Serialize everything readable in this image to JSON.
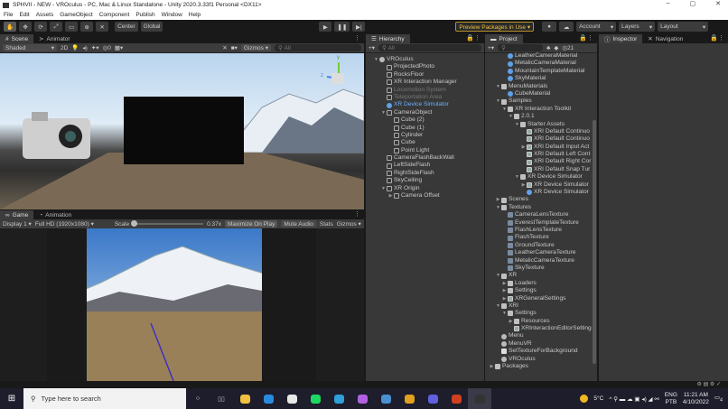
{
  "title": "SPHVII - NEW - VROculus - PC, Mac & Linux Standalone - Unity 2020.3.33f1 Personal <DX11>",
  "window_controls": [
    "–",
    "▢",
    "✕"
  ],
  "menu": [
    "File",
    "Edit",
    "Assets",
    "GameObject",
    "Component",
    "Publish",
    "Window",
    "Help"
  ],
  "toolbar": {
    "tools": [
      "✋",
      "✥",
      "⟳",
      "⤢",
      "▭",
      "⊕",
      "✕"
    ],
    "pivot": "Center",
    "space": "Global",
    "play": "▶",
    "pause": "❚❚",
    "step": "▶|",
    "preview": "Preview Packages in Use ▾",
    "account": "Account",
    "layers": "Layers",
    "layout": "Layout"
  },
  "scene": {
    "tabs": [
      "Scene",
      "Animator"
    ],
    "shading": "Shaded",
    "mode2d": "2D",
    "gizmos": "Gizmos",
    "search": "All",
    "axis_z": "z",
    "axis_y": "y"
  },
  "game": {
    "tabs": [
      "Game",
      "Animation"
    ],
    "display": "Display 1",
    "resolution": "Full HD (1920x1080)",
    "scale_label": "Scale",
    "scale_value": "0.37x",
    "scale_fraction": 0.0,
    "maximize": "Maximize On Play",
    "mute": "Mute Audio",
    "stats": "Stats",
    "gizmos": "Gizmos"
  },
  "hierarchy": {
    "tab": "Hierarchy",
    "search": "All",
    "items": [
      {
        "label": "VROculus",
        "level": 0,
        "icon": "scene",
        "arrow": "▼"
      },
      {
        "label": "ProjectedPhoto",
        "level": 1,
        "icon": "go"
      },
      {
        "label": "RocksFloor",
        "level": 1,
        "icon": "go"
      },
      {
        "label": "XR Interaction Manager",
        "level": 1,
        "icon": "go"
      },
      {
        "label": "Locomotion System",
        "level": 1,
        "icon": "go",
        "state": "dim"
      },
      {
        "label": "Teleportation Area",
        "level": 1,
        "icon": "go",
        "state": "dim"
      },
      {
        "label": "XR Device Simulator",
        "level": 1,
        "icon": "mat",
        "state": "sel"
      },
      {
        "label": "CameraObject",
        "level": 1,
        "icon": "go",
        "arrow": "▼"
      },
      {
        "label": "Cube (2)",
        "level": 2,
        "icon": "go"
      },
      {
        "label": "Cube (1)",
        "level": 2,
        "icon": "go"
      },
      {
        "label": "Cylinder",
        "level": 2,
        "icon": "go"
      },
      {
        "label": "Cube",
        "level": 2,
        "icon": "go"
      },
      {
        "label": "Point Light",
        "level": 2,
        "icon": "go"
      },
      {
        "label": "CameraFlashBackWall",
        "level": 1,
        "icon": "go"
      },
      {
        "label": "LeftSideFlash",
        "level": 1,
        "icon": "go"
      },
      {
        "label": "RightSideFlash",
        "level": 1,
        "icon": "go"
      },
      {
        "label": "SkyCeiling",
        "level": 1,
        "icon": "go"
      },
      {
        "label": "XR Origin",
        "level": 1,
        "icon": "go",
        "arrow": "▼"
      },
      {
        "label": "Camera Offset",
        "level": 2,
        "icon": "go",
        "arrow": "▶"
      }
    ]
  },
  "project": {
    "tab": "Project",
    "count": "21",
    "items": [
      {
        "label": "LeatherCameraMaterial",
        "level": 2,
        "icon": "mat"
      },
      {
        "label": "MetalicCameraMaterial",
        "level": 2,
        "icon": "mat"
      },
      {
        "label": "MountainTemplateMaterial",
        "level": 2,
        "icon": "mat"
      },
      {
        "label": "SkyMaterial",
        "level": 2,
        "icon": "mat"
      },
      {
        "label": "MenuMaterials",
        "level": 1,
        "icon": "folder",
        "arrow": "▼"
      },
      {
        "label": "CubeMaterial",
        "level": 2,
        "icon": "mat"
      },
      {
        "label": "Samples",
        "level": 1,
        "icon": "folder",
        "arrow": "▼"
      },
      {
        "label": "XR Interaction Toolkit",
        "level": 2,
        "icon": "folder",
        "arrow": "▼"
      },
      {
        "label": "2.0.1",
        "level": 3,
        "icon": "folder",
        "arrow": "▼"
      },
      {
        "label": "Starter Assets",
        "level": 4,
        "icon": "folder",
        "arrow": "▼"
      },
      {
        "label": "XRI Default Continuo",
        "level": 5,
        "icon": "asset"
      },
      {
        "label": "XRI Default Continuo",
        "level": 5,
        "icon": "asset"
      },
      {
        "label": "XRI Default Input Act",
        "level": 5,
        "icon": "asset",
        "arrow": "▶"
      },
      {
        "label": "XRI Default Left Cont",
        "level": 5,
        "icon": "asset"
      },
      {
        "label": "XRI Default Right Cor",
        "level": 5,
        "icon": "asset"
      },
      {
        "label": "XRI Default Snap Tur",
        "level": 5,
        "icon": "asset"
      },
      {
        "label": "XR Device Simulator",
        "level": 4,
        "icon": "folder",
        "arrow": "▼"
      },
      {
        "label": "XR Device Simulator",
        "level": 5,
        "icon": "asset",
        "arrow": "▶"
      },
      {
        "label": "XR Device Simulator",
        "level": 5,
        "icon": "mat"
      },
      {
        "label": "Scenes",
        "level": 1,
        "icon": "folder",
        "arrow": "▶"
      },
      {
        "label": "Textures",
        "level": 1,
        "icon": "folder",
        "arrow": "▼"
      },
      {
        "label": "CameraLensTexture",
        "level": 2,
        "icon": "tex"
      },
      {
        "label": "EverestTemplateTexture",
        "level": 2,
        "icon": "tex"
      },
      {
        "label": "FlashLensTexture",
        "level": 2,
        "icon": "tex"
      },
      {
        "label": "FlashTexture",
        "level": 2,
        "icon": "tex"
      },
      {
        "label": "GroundTexture",
        "level": 2,
        "icon": "tex"
      },
      {
        "label": "LeatherCameraTexture",
        "level": 2,
        "icon": "tex"
      },
      {
        "label": "MetalicCameraTexture",
        "level": 2,
        "icon": "tex"
      },
      {
        "label": "SkyTexture",
        "level": 2,
        "icon": "tex"
      },
      {
        "label": "XR",
        "level": 1,
        "icon": "folder",
        "arrow": "▼"
      },
      {
        "label": "Loaders",
        "level": 2,
        "icon": "folder",
        "arrow": "▶"
      },
      {
        "label": "Settings",
        "level": 2,
        "icon": "folder",
        "arrow": "▶"
      },
      {
        "label": "XRGeneralSettings",
        "level": 2,
        "icon": "asset",
        "arrow": "▶"
      },
      {
        "label": "XRI",
        "level": 1,
        "icon": "folder",
        "arrow": "▼"
      },
      {
        "label": "Settings",
        "level": 2,
        "icon": "folder",
        "arrow": "▼"
      },
      {
        "label": "Resources",
        "level": 3,
        "icon": "folder",
        "arrow": "▶"
      },
      {
        "label": "XRInteractionEditorSetting",
        "level": 3,
        "icon": "asset"
      },
      {
        "label": "Menu",
        "level": 1,
        "icon": "scene"
      },
      {
        "label": "MenuVR",
        "level": 1,
        "icon": "scene"
      },
      {
        "label": "SetTextureForBackground",
        "level": 1,
        "icon": "script"
      },
      {
        "label": "VROculus",
        "level": 1,
        "icon": "scene"
      },
      {
        "label": "Packages",
        "level": 0,
        "icon": "folder",
        "arrow": "▶"
      }
    ]
  },
  "inspector": {
    "tabs": [
      "Inspector",
      "Navigation"
    ]
  },
  "taskbar": {
    "search_placeholder": "Type here to search",
    "weather": "5°C",
    "lang1": "ENG",
    "lang2": "PTB",
    "time": "11:21 AM",
    "date": "4/10/2022",
    "notifications": "4",
    "apps": [
      {
        "name": "file-explorer",
        "color": "#f0c040"
      },
      {
        "name": "mail",
        "color": "#2a8ae0"
      },
      {
        "name": "store",
        "color": "#e8e8e8"
      },
      {
        "name": "spotify",
        "color": "#1ed760"
      },
      {
        "name": "edge",
        "color": "#2fa0d8"
      },
      {
        "name": "app",
        "color": "#b060e0"
      },
      {
        "name": "steam",
        "color": "#4a90d0"
      },
      {
        "name": "chrome",
        "color": "#e0a020"
      },
      {
        "name": "app2",
        "color": "#6060e0"
      },
      {
        "name": "powerpoint",
        "color": "#d04020"
      },
      {
        "name": "unity",
        "color": "#333"
      }
    ]
  }
}
